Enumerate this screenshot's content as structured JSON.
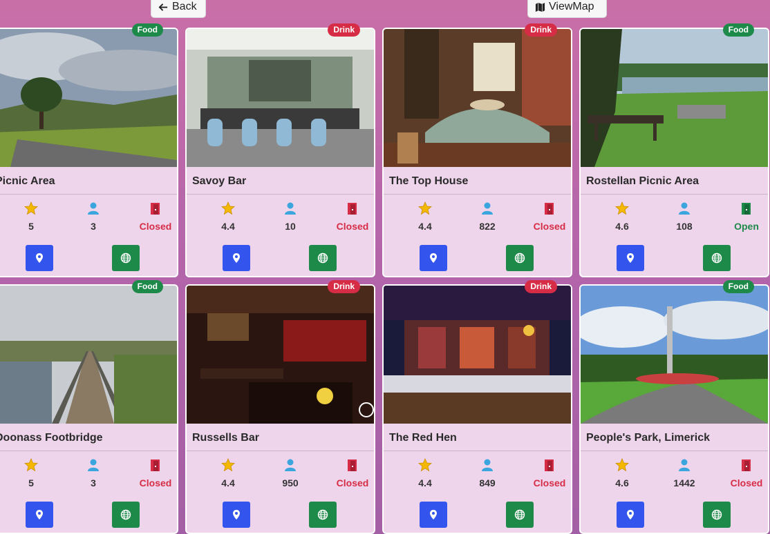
{
  "topbar": {
    "back_label": "Back",
    "map_label": "ViewMap"
  },
  "cards": [
    {
      "title": "Picnic Area",
      "category": "Food",
      "rating": "5",
      "reviews": "3",
      "status": "Closed",
      "scene": "landscape"
    },
    {
      "title": "Savoy Bar",
      "category": "Drink",
      "rating": "4.4",
      "reviews": "10",
      "status": "Closed",
      "scene": "bar-light"
    },
    {
      "title": "The Top House",
      "category": "Drink",
      "rating": "4.4",
      "reviews": "822",
      "status": "Closed",
      "scene": "pub"
    },
    {
      "title": "Rostellan Picnic Area",
      "category": "Food",
      "rating": "4.6",
      "reviews": "108",
      "status": "Open",
      "scene": "lake"
    },
    {
      "title": "Doonass Footbridge",
      "category": "Food",
      "rating": "5",
      "reviews": "3",
      "status": "Closed",
      "scene": "bridge"
    },
    {
      "title": "Russells Bar",
      "category": "Drink",
      "rating": "4.4",
      "reviews": "950",
      "status": "Closed",
      "scene": "bar-dark"
    },
    {
      "title": "The Red Hen",
      "category": "Drink",
      "rating": "4.4",
      "reviews": "849",
      "status": "Closed",
      "scene": "bar-red"
    },
    {
      "title": "People's Park, Limerick",
      "category": "Food",
      "rating": "4.6",
      "reviews": "1442",
      "status": "Closed",
      "scene": "park"
    }
  ],
  "colors": {
    "food": "#1e8a4a",
    "drink": "#d62c45",
    "location_button": "#3355ee",
    "website_button": "#1e8a4a"
  },
  "icons": {
    "rating": "star-icon",
    "reviews": "user-icon",
    "status": "door-icon",
    "location": "map-pin-icon",
    "website": "globe-icon"
  }
}
